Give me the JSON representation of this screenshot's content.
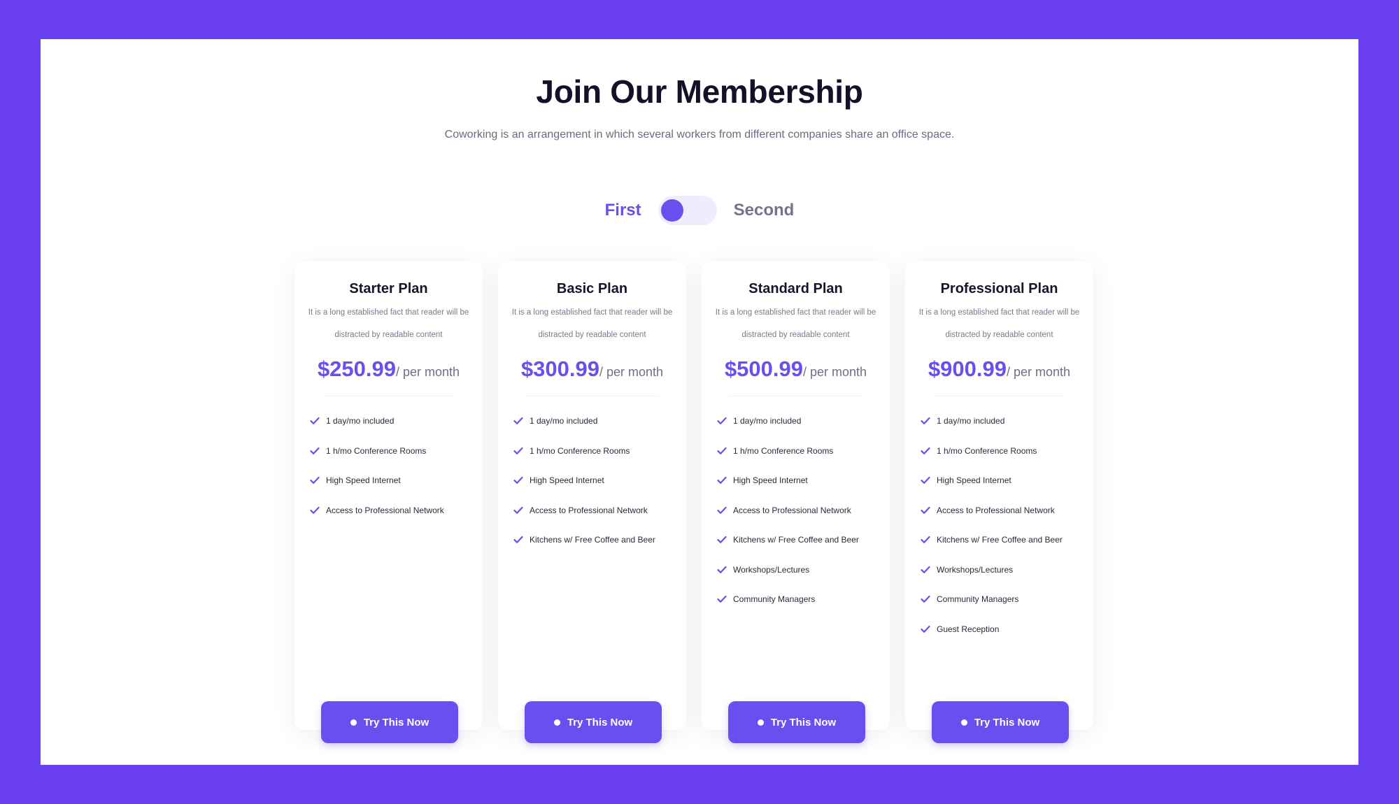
{
  "colors": {
    "frame_background": "#6a3ff2",
    "panel_background": "#ffffff",
    "accent": "#6a4ef0",
    "heading_text": "#141028",
    "muted_text": "#73738a",
    "toggle_track": "#efecfd"
  },
  "header": {
    "title": "Join Our Membership",
    "subtitle": "Coworking is an arrangement in which several workers from different companies share an office space."
  },
  "billing_toggle": {
    "option_first": "First",
    "option_second": "Second",
    "selected": "First"
  },
  "plans": [
    {
      "name": "Starter Plan",
      "description": "It is a long established fact that reader will be distracted by readable content",
      "price": "$250.99",
      "period": "/ per month",
      "features": [
        "1 day/mo included",
        "1 h/mo Conference Rooms",
        "High Speed Internet",
        "Access to Professional Network"
      ],
      "cta_label": "Try This Now"
    },
    {
      "name": "Basic Plan",
      "description": "It is a long established fact that reader will be distracted by readable content",
      "price": "$300.99",
      "period": "/ per month",
      "features": [
        "1 day/mo included",
        "1 h/mo Conference Rooms",
        "High Speed Internet",
        "Access to Professional Network",
        "Kitchens w/ Free Coffee and Beer"
      ],
      "cta_label": "Try This Now"
    },
    {
      "name": "Standard Plan",
      "description": "It is a long established fact that reader will be distracted by readable content",
      "price": "$500.99",
      "period": "/ per month",
      "features": [
        "1 day/mo included",
        "1 h/mo Conference Rooms",
        "High Speed Internet",
        "Access to Professional Network",
        "Kitchens w/ Free Coffee and Beer",
        "Workshops/Lectures",
        "Community Managers"
      ],
      "cta_label": "Try This Now"
    },
    {
      "name": "Professional Plan",
      "description": "It is a long established fact that reader will be distracted by readable content",
      "price": "$900.99",
      "period": "/ per month",
      "features": [
        "1 day/mo included",
        "1 h/mo Conference Rooms",
        "High Speed Internet",
        "Access to Professional Network",
        "Kitchens w/ Free Coffee and Beer",
        "Workshops/Lectures",
        "Community Managers",
        "Guest Reception"
      ],
      "cta_label": "Try This Now"
    }
  ],
  "icons": {
    "feature_check": "check-icon",
    "button_bullet": "dot-icon"
  }
}
